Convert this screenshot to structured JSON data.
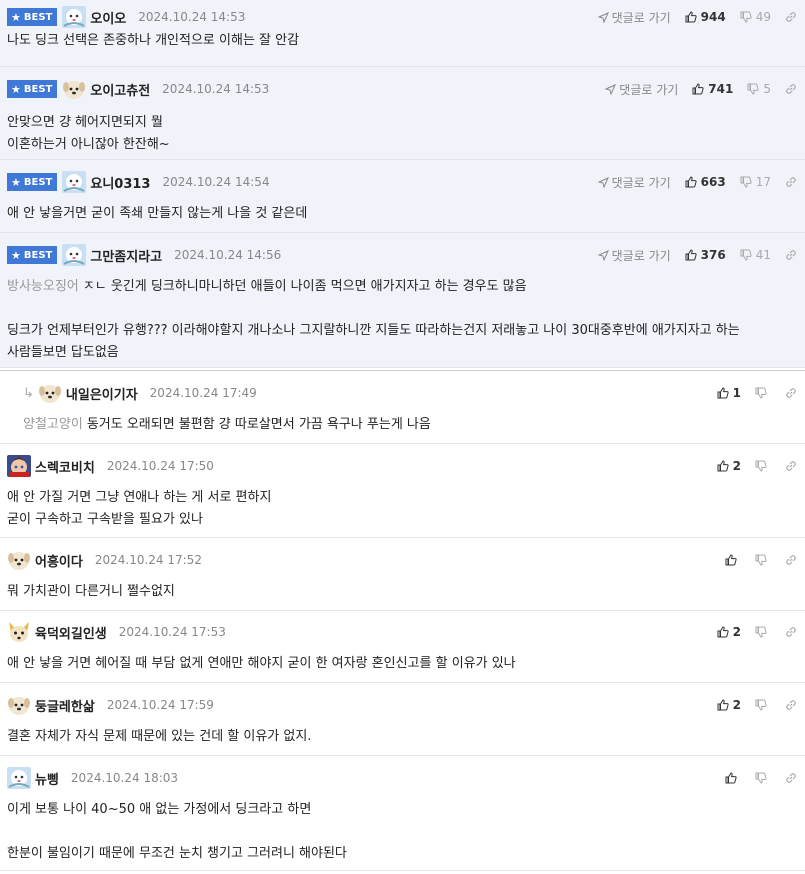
{
  "labels": {
    "best": "BEST",
    "reply_link": "댓글로 가기"
  },
  "comments": [
    {
      "nick": "오이오",
      "date": "2024.10.24 14:53",
      "best": true,
      "up": "944",
      "down": "49",
      "avatar": "snow",
      "lines": [
        "나도 딩크 선택은 존중하나 개인적으로 이해는 잘 안감"
      ]
    },
    {
      "nick": "오이고츄전",
      "date": "2024.10.24 14:53",
      "best": true,
      "up": "741",
      "down": "5",
      "avatar": "dog",
      "lines": [
        "안맞으면 걍 헤어지면되지 뭘",
        "이혼하는거 아니잖아 한잔해~"
      ]
    },
    {
      "nick": "요니0313",
      "date": "2024.10.24 14:54",
      "best": true,
      "up": "663",
      "down": "17",
      "avatar": "snow",
      "lines": [
        "애 안 낳을거면 굳이 족쇄 만들지 않는게 나을 것 같은데"
      ]
    },
    {
      "nick": "그만좀지라고",
      "date": "2024.10.24 14:56",
      "best": true,
      "up": "376",
      "down": "41",
      "avatar": "snow",
      "mention": "방사능오징어",
      "lines": [
        "ㅈㄴ 웃긴게 딩크하니마니하던 애들이 나이좀 먹으면 애가지자고 하는 경우도 많음",
        "",
        "딩크가 언제부터인가 유행??? 이라해야할지 개나소나 그지랄하니깐 지들도 따라하는건지 저래놓고 나이 30대중후반에 애가지자고 하는",
        "사람들보면 답도없음"
      ]
    },
    {
      "nick": "내일은이기자",
      "date": "2024.10.24 17:49",
      "reply": true,
      "up": "1",
      "down": "",
      "avatar": "dog",
      "mention": "양철고양이",
      "lines": [
        "동거도 오래되면 불편함 걍 따로살면서 가끔 욕구나 푸는게 나음"
      ]
    },
    {
      "nick": "스렉코비치",
      "date": "2024.10.24 17:50",
      "up": "2",
      "down": "",
      "avatar": "anime",
      "lines": [
        "애 안 가질 거면 그냥 연애나 하는 게 서로 편하지",
        "굳이 구속하고 구속받을 필요가 있나"
      ]
    },
    {
      "nick": "어흥이다",
      "date": "2024.10.24 17:52",
      "up": "",
      "down": "",
      "avatar": "dog",
      "lines": [
        "뭐 가치관이 다른거니 쩔수없지"
      ]
    },
    {
      "nick": "육덕외길인생",
      "date": "2024.10.24 17:53",
      "up": "2",
      "down": "",
      "avatar": "fox",
      "lines": [
        "애 안 낳을 거면 헤어질 때 부담 없게 연애만 해야지 굳이 한 여자랑 혼인신고를 할 이유가 있나"
      ]
    },
    {
      "nick": "둥글레한삶",
      "date": "2024.10.24 17:59",
      "up": "2",
      "down": "",
      "avatar": "dog",
      "lines": [
        "결혼 자체가 자식 문제 때문에 있는 건데 할 이유가 없지."
      ]
    },
    {
      "nick": "뉴삥",
      "date": "2024.10.24 18:03",
      "up": "",
      "down": "",
      "avatar": "snow",
      "lines": [
        "이게 보통 나이 40~50 애 없는 가정에서 딩크라고 하면",
        "",
        "한분이 불임이기 때문에 무조건 눈치 챙기고 그러려니 해야된다"
      ]
    }
  ]
}
